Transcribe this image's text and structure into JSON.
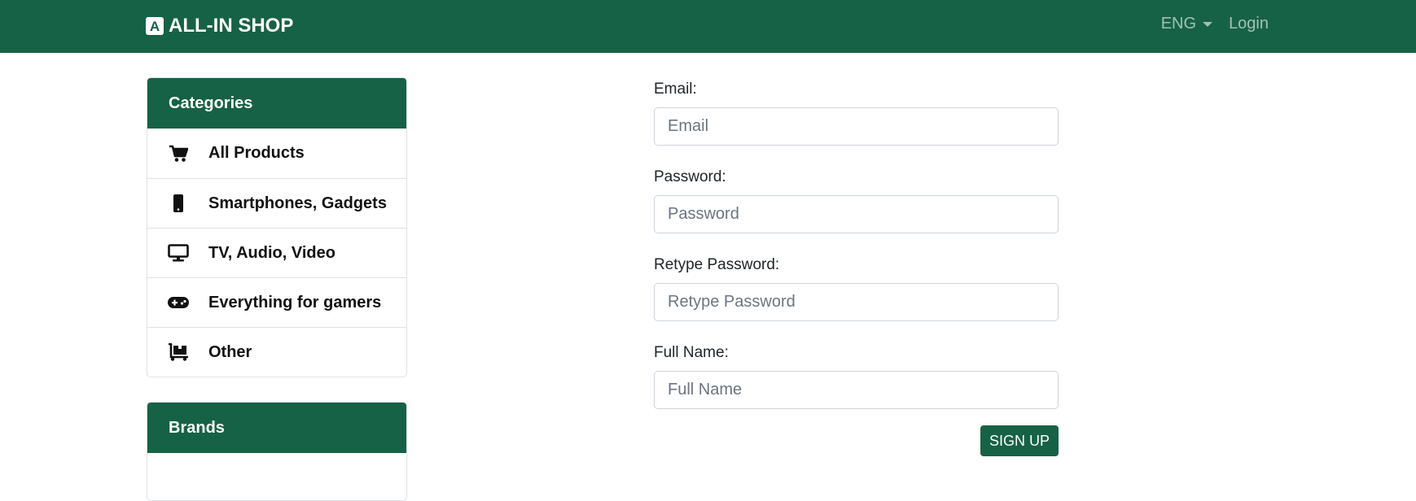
{
  "navbar": {
    "brand": "ALL-IN SHOP",
    "brand_logo_letter": "A",
    "language": "ENG",
    "login": "Login"
  },
  "sidebar": {
    "categories_title": "Categories",
    "categories": [
      {
        "label": "All Products",
        "icon": "cart-icon"
      },
      {
        "label": "Smartphones, Gadgets",
        "icon": "smartphone-icon"
      },
      {
        "label": "TV, Audio, Video",
        "icon": "monitor-icon"
      },
      {
        "label": "Everything for gamers",
        "icon": "gamepad-icon"
      },
      {
        "label": "Other",
        "icon": "dolly-icon"
      }
    ],
    "brands_title": "Brands"
  },
  "form": {
    "email_label": "Email:",
    "email_placeholder": "Email",
    "password_label": "Password:",
    "password_placeholder": "Password",
    "retype_label": "Retype Password:",
    "retype_placeholder": "Retype Password",
    "fullname_label": "Full Name:",
    "fullname_placeholder": "Full Name",
    "submit": "SIGN UP"
  },
  "colors": {
    "brand": "#166246",
    "border": "#dee2e6"
  }
}
